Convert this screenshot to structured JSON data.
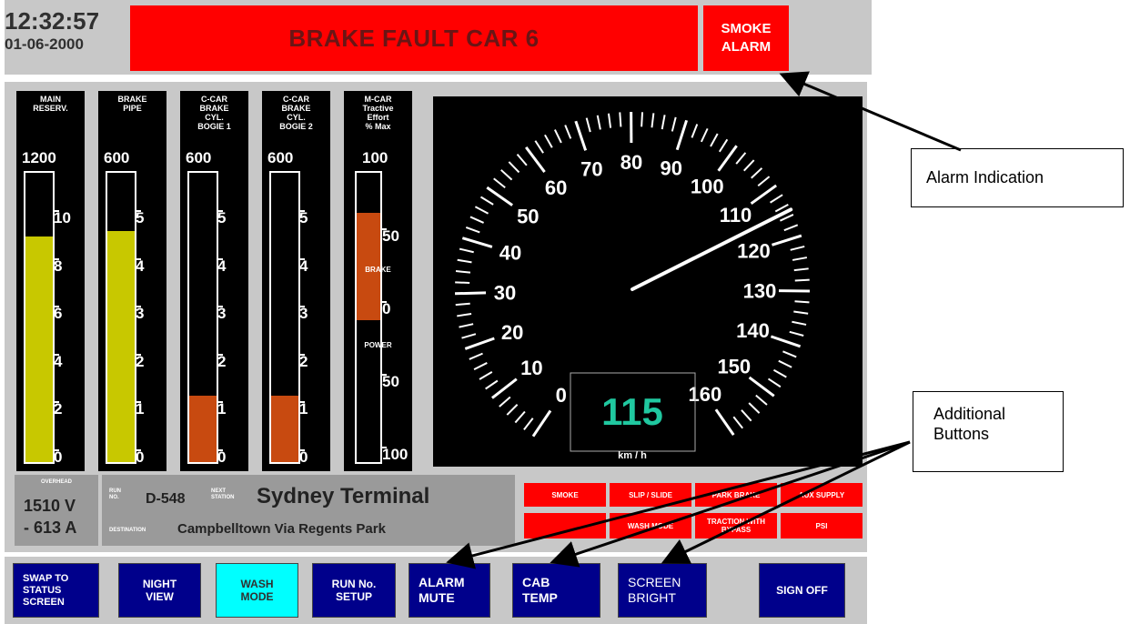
{
  "header": {
    "time": "12:32:57",
    "date": "01-06-2000",
    "fault_message": "BRAKE FAULT CAR 6",
    "smoke_alarm": [
      "SMOKE",
      "ALARM"
    ]
  },
  "gauges": [
    {
      "label": [
        "MAIN",
        "RESERV."
      ],
      "max": "1200",
      "ticks": [
        "10",
        "8",
        "6",
        "4",
        "2",
        "0"
      ],
      "level": 0.78,
      "fill_color": "#c8c800"
    },
    {
      "label": [
        "BRAKE",
        "PIPE"
      ],
      "max": "600",
      "ticks": [
        "5",
        "4",
        "3",
        "2",
        "1",
        "0"
      ],
      "level": 0.8,
      "fill_color": "#c8c800"
    },
    {
      "label": [
        "C-CAR",
        "BRAKE",
        "CYL.",
        "BOGIE 1"
      ],
      "max": "600",
      "ticks": [
        "5",
        "4",
        "3",
        "2",
        "1",
        "0"
      ],
      "level": 0.23,
      "fill_color": "#c84a10"
    },
    {
      "label": [
        "C-CAR",
        "BRAKE",
        "CYL.",
        "BOGIE 2"
      ],
      "max": "600",
      "ticks": [
        "5",
        "4",
        "3",
        "2",
        "1",
        "0"
      ],
      "level": 0.23,
      "fill_color": "#c84a10"
    },
    {
      "label": [
        "M-CAR",
        "Tractive",
        "Effort",
        "% Max"
      ],
      "max": "100",
      "ticks": [
        "50",
        "0",
        "50",
        "100"
      ],
      "brake_word": "BRAKE",
      "power_word": "POWER",
      "fill_color": "#c84a10"
    }
  ],
  "speedometer": {
    "labels": [
      "0",
      "10",
      "20",
      "30",
      "40",
      "50",
      "60",
      "70",
      "80",
      "90",
      "100",
      "110",
      "120",
      "130",
      "140",
      "150",
      "160"
    ],
    "speed": "115",
    "unit": "km / h",
    "speed_value": 115,
    "speed_color": "#20c8a0"
  },
  "overhead": {
    "title": "OVERHEAD",
    "voltage": "1510 V",
    "current": "- 613 A"
  },
  "run": {
    "run_label": [
      "RUN",
      "NO."
    ],
    "run_no": "D-548",
    "next_label": [
      "NEXT",
      "STATION"
    ],
    "next_station": "Sydney Terminal",
    "dest_label": "DESTINATION",
    "destination": "Campbelltown Via Regents Park"
  },
  "status_buttons": [
    "SMOKE",
    "SLIP / SLIDE",
    "PARK BRAKE",
    "AUX SUPPLY",
    "",
    "WASH MODE",
    "TRACTION WITH BYPASS",
    "PSI"
  ],
  "buttons": {
    "swap": [
      "SWAP TO",
      "STATUS",
      "SCREEN"
    ],
    "night": [
      "NIGHT",
      "VIEW"
    ],
    "wash": [
      "WASH",
      "MODE"
    ],
    "run_setup": [
      "RUN No.",
      "SETUP"
    ],
    "alarm_mute": [
      "ALARM",
      "MUTE"
    ],
    "cab_temp": [
      "CAB",
      "TEMP"
    ],
    "screen_bright": [
      "SCREEN",
      "BRIGHT"
    ],
    "sign_off": "SIGN OFF"
  },
  "callouts": {
    "alarm": "Alarm Indication",
    "additional": [
      "Additional",
      "Buttons"
    ]
  },
  "colors": {
    "alarm_red": "#ff0000",
    "button_blue": "#00008b",
    "wash_cyan": "#00ffff",
    "panel_grey": "#c8c8c8"
  }
}
